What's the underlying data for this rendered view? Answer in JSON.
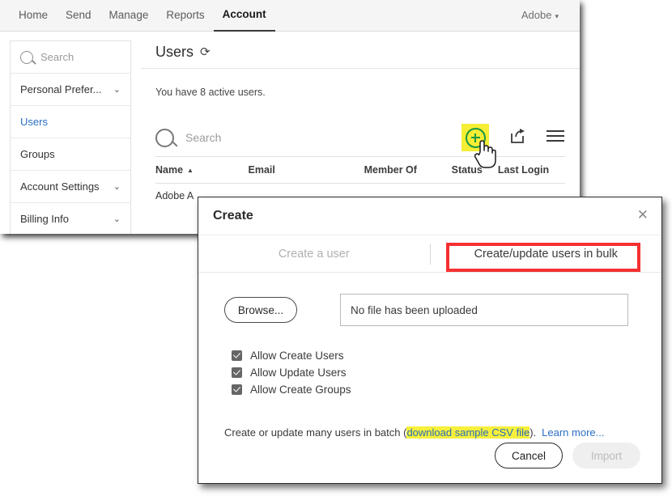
{
  "topnav": {
    "items": [
      {
        "label": "Home",
        "active": false
      },
      {
        "label": "Send",
        "active": false
      },
      {
        "label": "Manage",
        "active": false
      },
      {
        "label": "Reports",
        "active": false
      },
      {
        "label": "Account",
        "active": true
      }
    ],
    "account_menu": "Adobe",
    "caret": "▾"
  },
  "sidebar": {
    "search_placeholder": "Search",
    "items": [
      {
        "label": "Personal Prefer...",
        "chevron": "⌄"
      },
      {
        "label": "Users",
        "chevron": ""
      },
      {
        "label": "Groups",
        "chevron": ""
      },
      {
        "label": "Account Settings",
        "chevron": "⌄"
      },
      {
        "label": "Billing Info",
        "chevron": "⌄"
      }
    ]
  },
  "content": {
    "page_title": "Users",
    "refresh_icon": "⟳",
    "active_users_text": "You have 8 active users."
  },
  "toolbar": {
    "search_placeholder": "Search",
    "add_user_icon": "plus-circle-icon",
    "share_icon": "share-icon",
    "menu_icon": "hamburger-menu-icon"
  },
  "table": {
    "columns": [
      "Name",
      "Email",
      "Member Of",
      "Status",
      "Last Login"
    ],
    "sort_arrow": "▲",
    "rows": [
      {
        "name": "Adobe A",
        "email": "",
        "member_of": "",
        "status": "",
        "last_login": ""
      }
    ]
  },
  "dialog": {
    "title": "Create",
    "close_icon": "✕",
    "tabs": [
      {
        "label": "Create a user",
        "active": false
      },
      {
        "label": "Create/update users in bulk",
        "active": true
      }
    ],
    "browse_label": "Browse...",
    "file_field_value": "No file has been uploaded",
    "permissions": [
      {
        "label": "Allow Create Users",
        "checked": true
      },
      {
        "label": "Allow Update Users",
        "checked": true
      },
      {
        "label": "Allow Create Groups",
        "checked": true
      }
    ],
    "batch_note_prefix": "Create or update many users in batch (",
    "batch_note_link": "download sample CSV file",
    "batch_note_suffix": ").",
    "learn_more": "Learn more...",
    "cancel_label": "Cancel",
    "import_label": "Import"
  },
  "colors": {
    "accent_blue": "#2a6fc4",
    "highlight_yellow": "#f5ee35",
    "annotation_red": "#f53030",
    "add_icon_green": "#1a9641"
  }
}
